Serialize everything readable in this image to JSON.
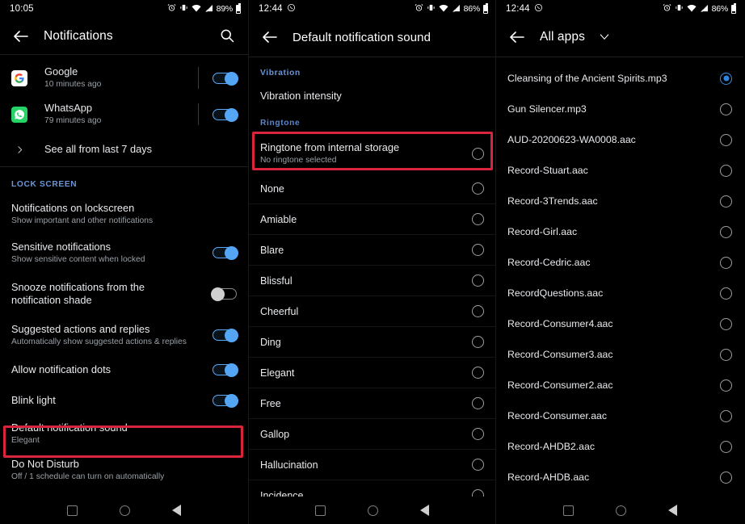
{
  "panels": [
    {
      "id": "notifications-settings",
      "status_bar": {
        "time": "10:05",
        "battery_percent": "89%",
        "icons": [
          "alarm-icon",
          "vibrate-icon",
          "wifi-icon",
          "signal-icon",
          "battery-icon"
        ]
      },
      "appbar": {
        "title": "Notifications",
        "back_icon": "back-arrow-icon",
        "action_icon": "search-icon"
      },
      "notifications": [
        {
          "app": "Google",
          "time": "10 minutes ago",
          "logo": "google-icon",
          "toggle": "on"
        },
        {
          "app": "WhatsApp",
          "time": "79 minutes ago",
          "logo": "whatsapp-icon",
          "toggle": "on"
        }
      ],
      "see_all": "See all from last 7 days",
      "lock_screen_header": "LOCK SCREEN",
      "settings": [
        {
          "title": "Notifications on lockscreen",
          "subtitle": "Show important and other notifications",
          "toggle": "none"
        },
        {
          "title": "Sensitive notifications",
          "subtitle": "Show sensitive content when locked",
          "toggle": "on"
        },
        {
          "title": "Snooze notifications from the notification shade",
          "subtitle": "",
          "toggle": "off"
        },
        {
          "title": "Suggested actions and replies",
          "subtitle": "Automatically show suggested actions & replies",
          "toggle": "on"
        },
        {
          "title": "Allow notification dots",
          "subtitle": "",
          "toggle": "on"
        },
        {
          "title": "Blink light",
          "subtitle": "",
          "toggle": "on"
        },
        {
          "title": "Default notification sound",
          "subtitle": "Elegant",
          "toggle": "none",
          "highlighted": true
        },
        {
          "title": "Do Not Disturb",
          "subtitle": "Off / 1 schedule can turn on automatically",
          "toggle": "none"
        }
      ]
    },
    {
      "id": "default-notification-sound",
      "status_bar": {
        "time": "12:44",
        "battery_percent": "86%",
        "icons": [
          "whatsapp-status-icon",
          "alarm-icon",
          "vibrate-icon",
          "wifi-icon",
          "signal-icon",
          "battery-icon"
        ]
      },
      "appbar": {
        "title": "Default notification sound",
        "back_icon": "back-arrow-icon"
      },
      "vibration_header": "Vibration",
      "vibration_item": "Vibration intensity",
      "ringtone_header": "Ringtone",
      "internal_storage": {
        "title": "Ringtone from internal storage",
        "subtitle": "No ringtone selected",
        "selected": false,
        "highlighted": true
      },
      "ringtones": [
        {
          "name": "None",
          "selected": false
        },
        {
          "name": "Amiable",
          "selected": false
        },
        {
          "name": "Blare",
          "selected": false
        },
        {
          "name": "Blissful",
          "selected": false
        },
        {
          "name": "Cheerful",
          "selected": false
        },
        {
          "name": "Ding",
          "selected": false
        },
        {
          "name": "Elegant",
          "selected": false
        },
        {
          "name": "Free",
          "selected": false
        },
        {
          "name": "Gallop",
          "selected": false
        },
        {
          "name": "Hallucination",
          "selected": false
        },
        {
          "name": "Incidence",
          "selected": false
        }
      ]
    },
    {
      "id": "all-apps-file-picker",
      "status_bar": {
        "time": "12:44",
        "battery_percent": "86%",
        "icons": [
          "whatsapp-status-icon",
          "alarm-icon",
          "vibrate-icon",
          "wifi-icon",
          "signal-icon",
          "battery-icon"
        ]
      },
      "appbar": {
        "title": "All apps",
        "back_icon": "back-arrow-icon",
        "caret_icon": "chevron-down-icon"
      },
      "files": [
        {
          "name": "Cleansing of the Ancient Spirits.mp3",
          "selected": true
        },
        {
          "name": "Gun Silencer.mp3",
          "selected": false
        },
        {
          "name": "AUD-20200623-WA0008.aac",
          "selected": false
        },
        {
          "name": "Record-Stuart.aac",
          "selected": false
        },
        {
          "name": "Record-3Trends.aac",
          "selected": false
        },
        {
          "name": "Record-Girl.aac",
          "selected": false
        },
        {
          "name": "Record-Cedric.aac",
          "selected": false
        },
        {
          "name": "RecordQuestions.aac",
          "selected": false
        },
        {
          "name": "Record-Consumer4.aac",
          "selected": false
        },
        {
          "name": "Record-Consumer3.aac",
          "selected": false
        },
        {
          "name": "Record-Consumer2.aac",
          "selected": false
        },
        {
          "name": "Record-Consumer.aac",
          "selected": false
        },
        {
          "name": "Record-AHDB2.aac",
          "selected": false
        },
        {
          "name": "Record-AHDB.aac",
          "selected": false
        }
      ]
    }
  ],
  "navbar": {
    "recents_icon": "square-recents-icon",
    "home_icon": "circle-home-icon",
    "back_icon": "triangle-back-icon"
  },
  "colors": {
    "accent_blue": "#54a6f5",
    "section_header_blue": "#6b95d8",
    "highlight_red": "#d9253c",
    "background": "#000000",
    "text_primary": "#e8eaed",
    "text_secondary": "#9aa0a6"
  }
}
